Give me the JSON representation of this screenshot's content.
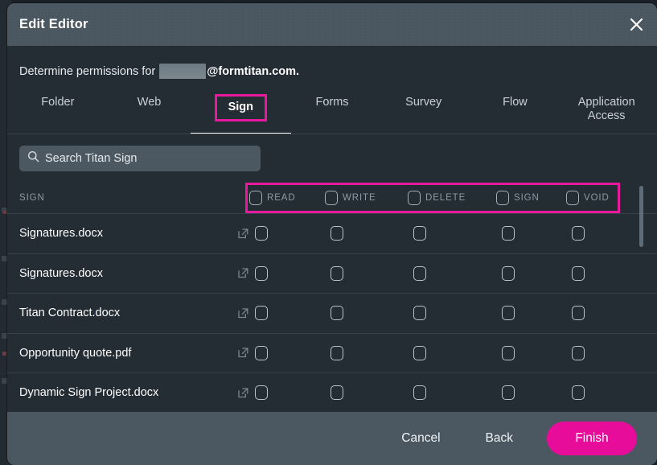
{
  "window": {
    "title": "Edit  Editor",
    "close_icon": "close-icon"
  },
  "subtitle": {
    "lead": "Determine permissions for",
    "redacted": "",
    "domain": "@formtitan.com."
  },
  "tabs": {
    "items": [
      {
        "label": "Folder",
        "active": false
      },
      {
        "label": "Web",
        "active": false
      },
      {
        "label": "Sign",
        "active": true
      },
      {
        "label": "Forms",
        "active": false
      },
      {
        "label": "Survey",
        "active": false
      },
      {
        "label": "Flow",
        "active": false
      },
      {
        "label": "Application\nAccess",
        "active": false
      }
    ]
  },
  "search": {
    "placeholder": "Search Titan Sign",
    "value": "",
    "icon": "search-icon"
  },
  "table": {
    "name_header": "SIGN",
    "columns": [
      "READ",
      "WRITE",
      "DELETE",
      "SIGN",
      "VOID"
    ],
    "rows": [
      {
        "name": "Signatures.docx",
        "permissions": [
          false,
          false,
          false,
          false,
          false
        ]
      },
      {
        "name": "Signatures.docx",
        "permissions": [
          false,
          false,
          false,
          false,
          false
        ]
      },
      {
        "name": "Titan Contract.docx",
        "permissions": [
          false,
          false,
          false,
          false,
          false
        ]
      },
      {
        "name": "Opportunity quote.pdf",
        "permissions": [
          false,
          false,
          false,
          false,
          false
        ]
      },
      {
        "name": "Dynamic Sign Project.docx",
        "permissions": [
          false,
          false,
          false,
          false,
          false
        ]
      }
    ]
  },
  "footer": {
    "cancel_label": "Cancel",
    "back_label": "Back",
    "finish_label": "Finish"
  },
  "colors": {
    "accent": "#e9199d",
    "primary_button": "#e80c9a",
    "modal_bg": "#242c34",
    "bar_bg": "#4b5760"
  }
}
